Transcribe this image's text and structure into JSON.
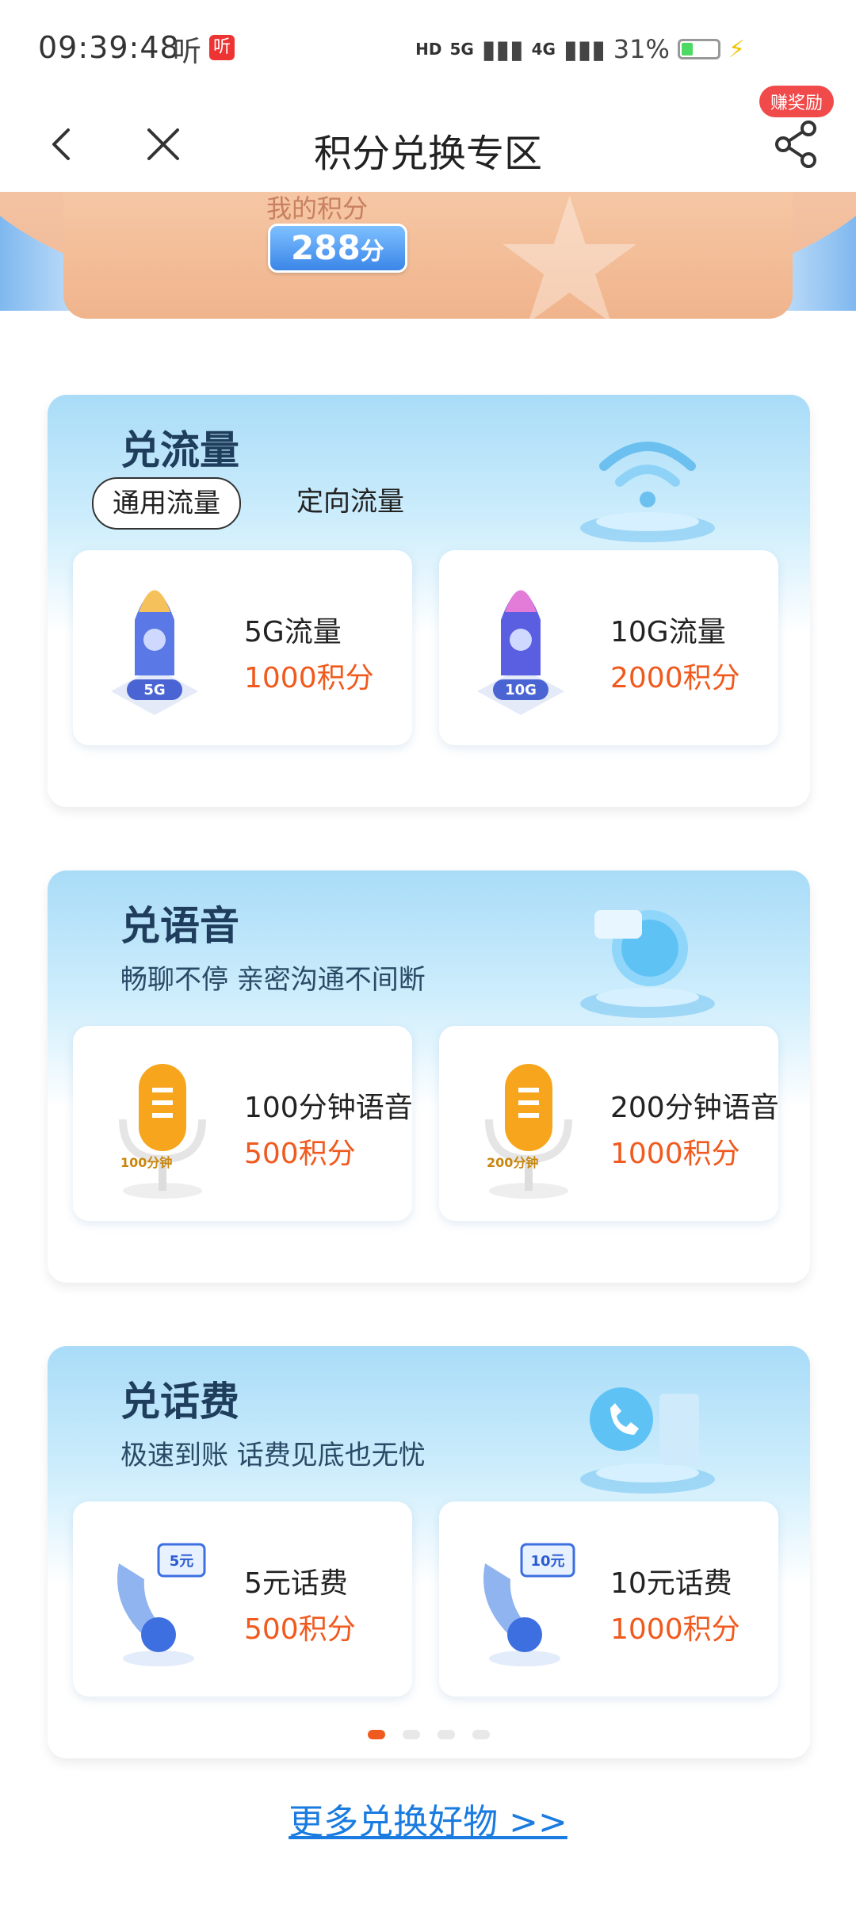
{
  "status_bar": {
    "time": "09:39:48",
    "ting": "听",
    "app_badge": "听",
    "hd": "HD",
    "net1": "5G",
    "net2": "4G",
    "battery_pct": "31%",
    "battery_level": 0.31
  },
  "nav": {
    "title": "积分兑换专区",
    "reward_badge": "赚奖励"
  },
  "banner": {
    "points_label": "我的积分",
    "points_value": "288",
    "points_unit": "分"
  },
  "sections": [
    {
      "title": "兑流量",
      "tabs": [
        "通用流量",
        "定向流量"
      ],
      "items": [
        {
          "name": "5G流量",
          "cost": "1000积分",
          "img_tag": "5G"
        },
        {
          "name": "10G流量",
          "cost": "2000积分",
          "img_tag": "10G"
        }
      ]
    },
    {
      "title": "兑语音",
      "subtitle": "畅聊不停  亲密沟通不间断",
      "items": [
        {
          "name": "100分钟语音",
          "cost": "500积分",
          "img_tag": "100分钟"
        },
        {
          "name": "200分钟语音",
          "cost": "1000积分",
          "img_tag": "200分钟"
        }
      ]
    },
    {
      "title": "兑话费",
      "subtitle": "极速到账  话费见底也无忧",
      "items": [
        {
          "name": "5元话费",
          "cost": "500积分",
          "img_tag": "5元"
        },
        {
          "name": "10元话费",
          "cost": "1000积分",
          "img_tag": "10元"
        }
      ]
    }
  ],
  "pager": {
    "count": 4,
    "active": 0
  },
  "more_link": "更多兑换好物 >>",
  "colors": {
    "accent_orange": "#f05a1e",
    "link_blue": "#1a7be0",
    "title_navy": "#1f3d5c"
  }
}
